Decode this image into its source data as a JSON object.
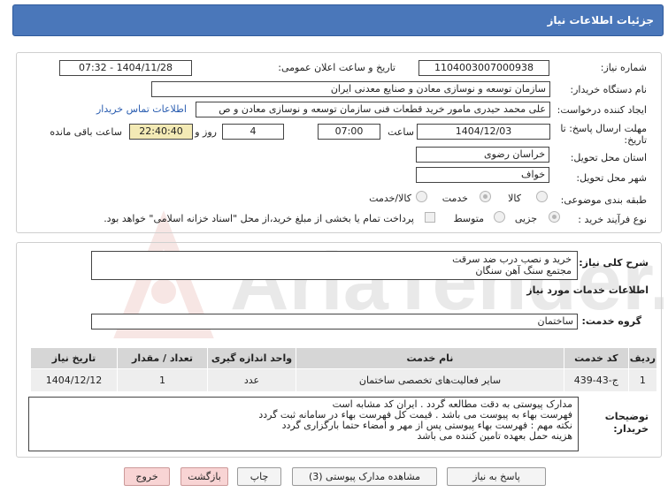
{
  "header": {
    "title": "جزئیات اطلاعات نیاز"
  },
  "watermark": {
    "text": "AriaTender.neT"
  },
  "form": {
    "need_number_label": "شماره نیاز:",
    "need_number": "1104003007000938",
    "announce_label": "تاریخ و ساعت اعلان عمومی:",
    "announce_value": "1404/11/28 - 07:32",
    "buyer_org_label": "نام دستگاه خریدار:",
    "buyer_org": "سازمان توسعه و نوسازی معادن و صنایع معدنی ایران",
    "creator_label": "ایجاد کننده درخواست:",
    "creator": "علی محمد حیدری مامور خرید قطعات فنی سازمان توسعه و نوسازی معادن و ص",
    "contact_link": "اطلاعات تماس خریدار",
    "deadline_label_1": "مهلت ارسال پاسخ: تا",
    "deadline_label_2": "تاریخ:",
    "deadline_date": "1404/12/03",
    "time_label": "ساعت",
    "deadline_time": "07:00",
    "days_value": "4",
    "days_label": "روز و",
    "remaining_time": "22:40:40",
    "remaining_label": "ساعت باقی مانده",
    "province_label": "استان محل تحویل:",
    "province": "خراسان رضوی",
    "city_label": "شهر محل تحویل:",
    "city": "خواف",
    "category_label": "طبقه بندی موضوعی:",
    "category_options": [
      "کالا",
      "خدمت",
      "کالا/خدمت"
    ],
    "category_selected": "خدمت",
    "process_label": "نوع فرآیند خرید :",
    "process_options": [
      "جزیی",
      "متوسط"
    ],
    "process_selected": "جزیی",
    "payment_note": "پرداخت تمام یا بخشی از مبلغ خرید،از محل \"اسناد خزانه اسلامی\" خواهد بود."
  },
  "need": {
    "summary_label": "شرح کلی نیاز:",
    "summary_lines": [
      "خرید و نصب درب ضد سرقت",
      "مجتمع سنگ آهن سنگان"
    ],
    "services_heading": "اطلاعات خدمات مورد نیاز",
    "group_label": "گروه خدمت:",
    "group_value": "ساختمان"
  },
  "table": {
    "headers": [
      "ردیف",
      "کد خدمت",
      "نام خدمت",
      "واحد اندازه گیری",
      "تعداد / مقدار",
      "تاریخ نیاز"
    ],
    "rows": [
      [
        "1",
        "ج-43-439",
        "سایر فعالیت‌های تخصصی ساختمان",
        "عدد",
        "1",
        "1404/12/12"
      ]
    ]
  },
  "buyer_notes": {
    "label_1": "توضیحات",
    "label_2": "خریدار:",
    "lines": [
      "مدارک پیوستی به دقت مطالعه گردد . ایران کد مشابه است",
      "فهرست بهاء به پیوست می باشد . قیمت کل فهرست بهاء در سامانه ثبت گردد",
      "نکته مهم : فهرست بهاء پیوستی پس از مهر و امضاء حتما بارگزاری گردد",
      "هزینه حمل بعهده تامین کننده می باشد"
    ]
  },
  "buttons": {
    "reply": "پاسخ به نیاز",
    "attachments": "مشاهده مدارک پیوستی (3)",
    "print": "چاپ",
    "back": "بازگشت",
    "exit": "خروج"
  },
  "colors": {
    "header": "#4a77ba",
    "time_box": "#f3eab5",
    "link": "#2a5db0"
  }
}
